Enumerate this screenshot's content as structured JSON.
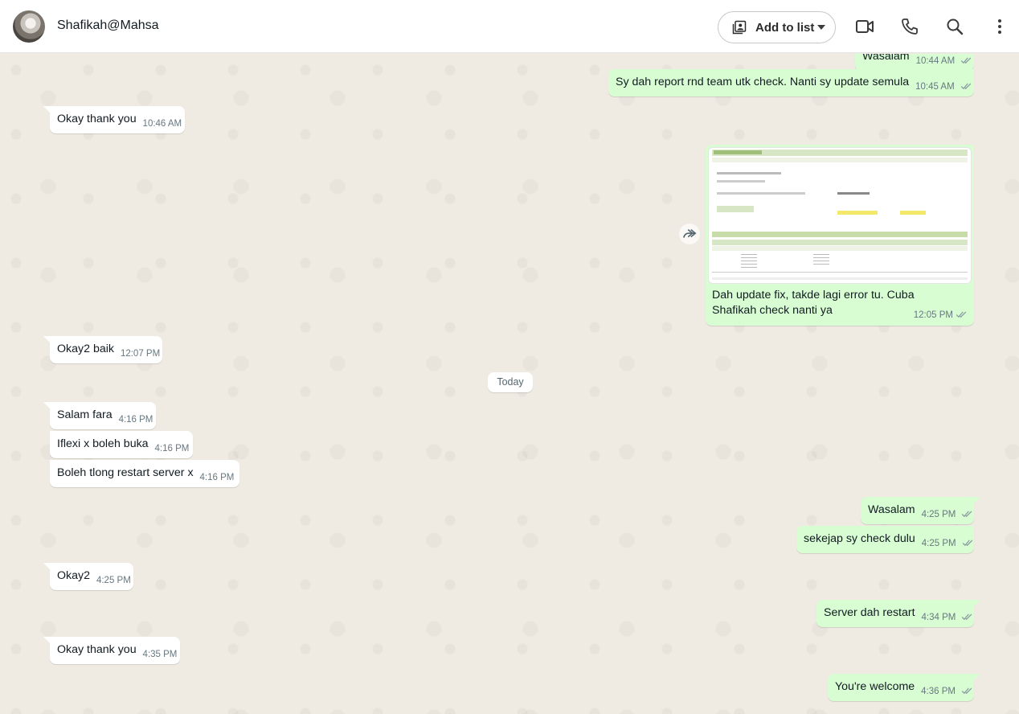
{
  "header": {
    "contact_name": "Shafikah@Mahsa",
    "add_to_list_label": "Add to list",
    "icons": [
      "add-to-list-icon",
      "dropdown-caret-icon",
      "video-call-icon",
      "voice-call-icon",
      "search-icon",
      "more-options-icon"
    ]
  },
  "colors": {
    "incoming": "#ffffff",
    "outgoing": "#d9fdd3",
    "background": "#efeae2",
    "ticks": "#53bdeb"
  },
  "messages": [
    {
      "dir": "out",
      "text": "Wasalam",
      "time": "10:44 AM"
    },
    {
      "dir": "out",
      "text": "Sy dah report rnd team utk check. Nanti sy update semula",
      "time": "10:45 AM"
    },
    {
      "dir": "in",
      "text": "Okay thank you",
      "time": "10:46 AM"
    },
    {
      "dir": "out",
      "type": "image",
      "caption": "Dah update fix, takde lagi error tu. Cuba Shafikah check nanti ya",
      "time": "12:05 PM"
    },
    {
      "dir": "in",
      "text": "Okay2 baik",
      "time": "12:07 PM"
    },
    {
      "dir": "in",
      "text": "Salam fara",
      "time": "4:16 PM"
    },
    {
      "dir": "in",
      "text": "Iflexi x boleh buka",
      "time": "4:16 PM"
    },
    {
      "dir": "in",
      "text": "Boleh tlong restart server x",
      "time": "4:16 PM"
    },
    {
      "dir": "out",
      "text": "Wasalam",
      "time": "4:25 PM"
    },
    {
      "dir": "out",
      "text": "sekejap sy check dulu",
      "time": "4:25 PM"
    },
    {
      "dir": "in",
      "text": "Okay2",
      "time": "4:25 PM"
    },
    {
      "dir": "out",
      "text": "Server dah restart",
      "time": "4:34 PM"
    },
    {
      "dir": "in",
      "text": "Okay thank you",
      "time": "4:35 PM"
    },
    {
      "dir": "out",
      "text": "You're welcome",
      "time": "4:36 PM"
    }
  ],
  "date_divider": "Today"
}
